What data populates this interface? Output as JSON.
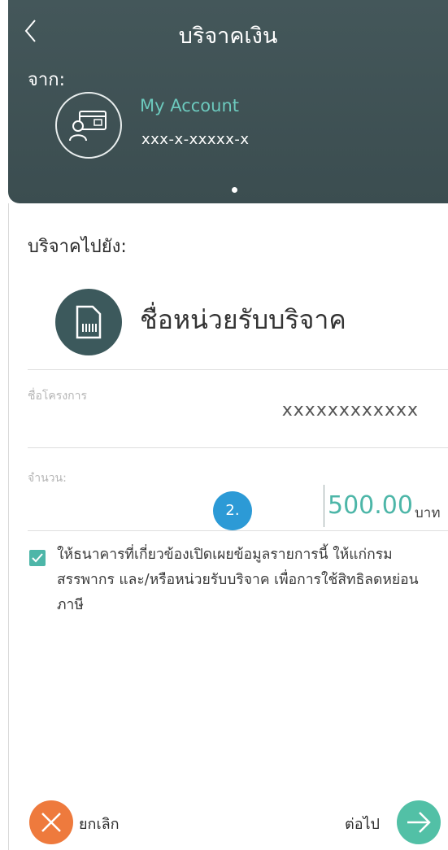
{
  "header": {
    "title": "บริจาคเงิน",
    "from_label": "จาก:",
    "account": {
      "name": "My Account",
      "number": "xxx-x-xxxxx-x"
    }
  },
  "destination": {
    "label": "บริจาคไปยัง:",
    "org_name": "ชื่อหน่วยรับบริจาค"
  },
  "project": {
    "label": "ชื่อโครงการ",
    "value": "xxxxxxxxxxxx"
  },
  "amount": {
    "label": "จำนวน:",
    "value": "500.00",
    "unit": "บาท"
  },
  "step_badge": "2.",
  "consent": {
    "checked": true,
    "text": "ให้ธนาคารที่เกี่ยวข้องเปิดเผยข้อมูลรายการนี้ ให้แก่กรมสรรพากร และ/หรือหน่วยรับบริจาค เพื่อการใช้สิทธิลดหย่อนภาษี"
  },
  "footer": {
    "cancel_label": "ยกเลิก",
    "next_label": "ต่อไป"
  },
  "colors": {
    "header_bg": "#3f5154",
    "accent_teal": "#4db6a8",
    "cancel_orange": "#ee7a3d",
    "step_blue": "#2c9ad6"
  }
}
